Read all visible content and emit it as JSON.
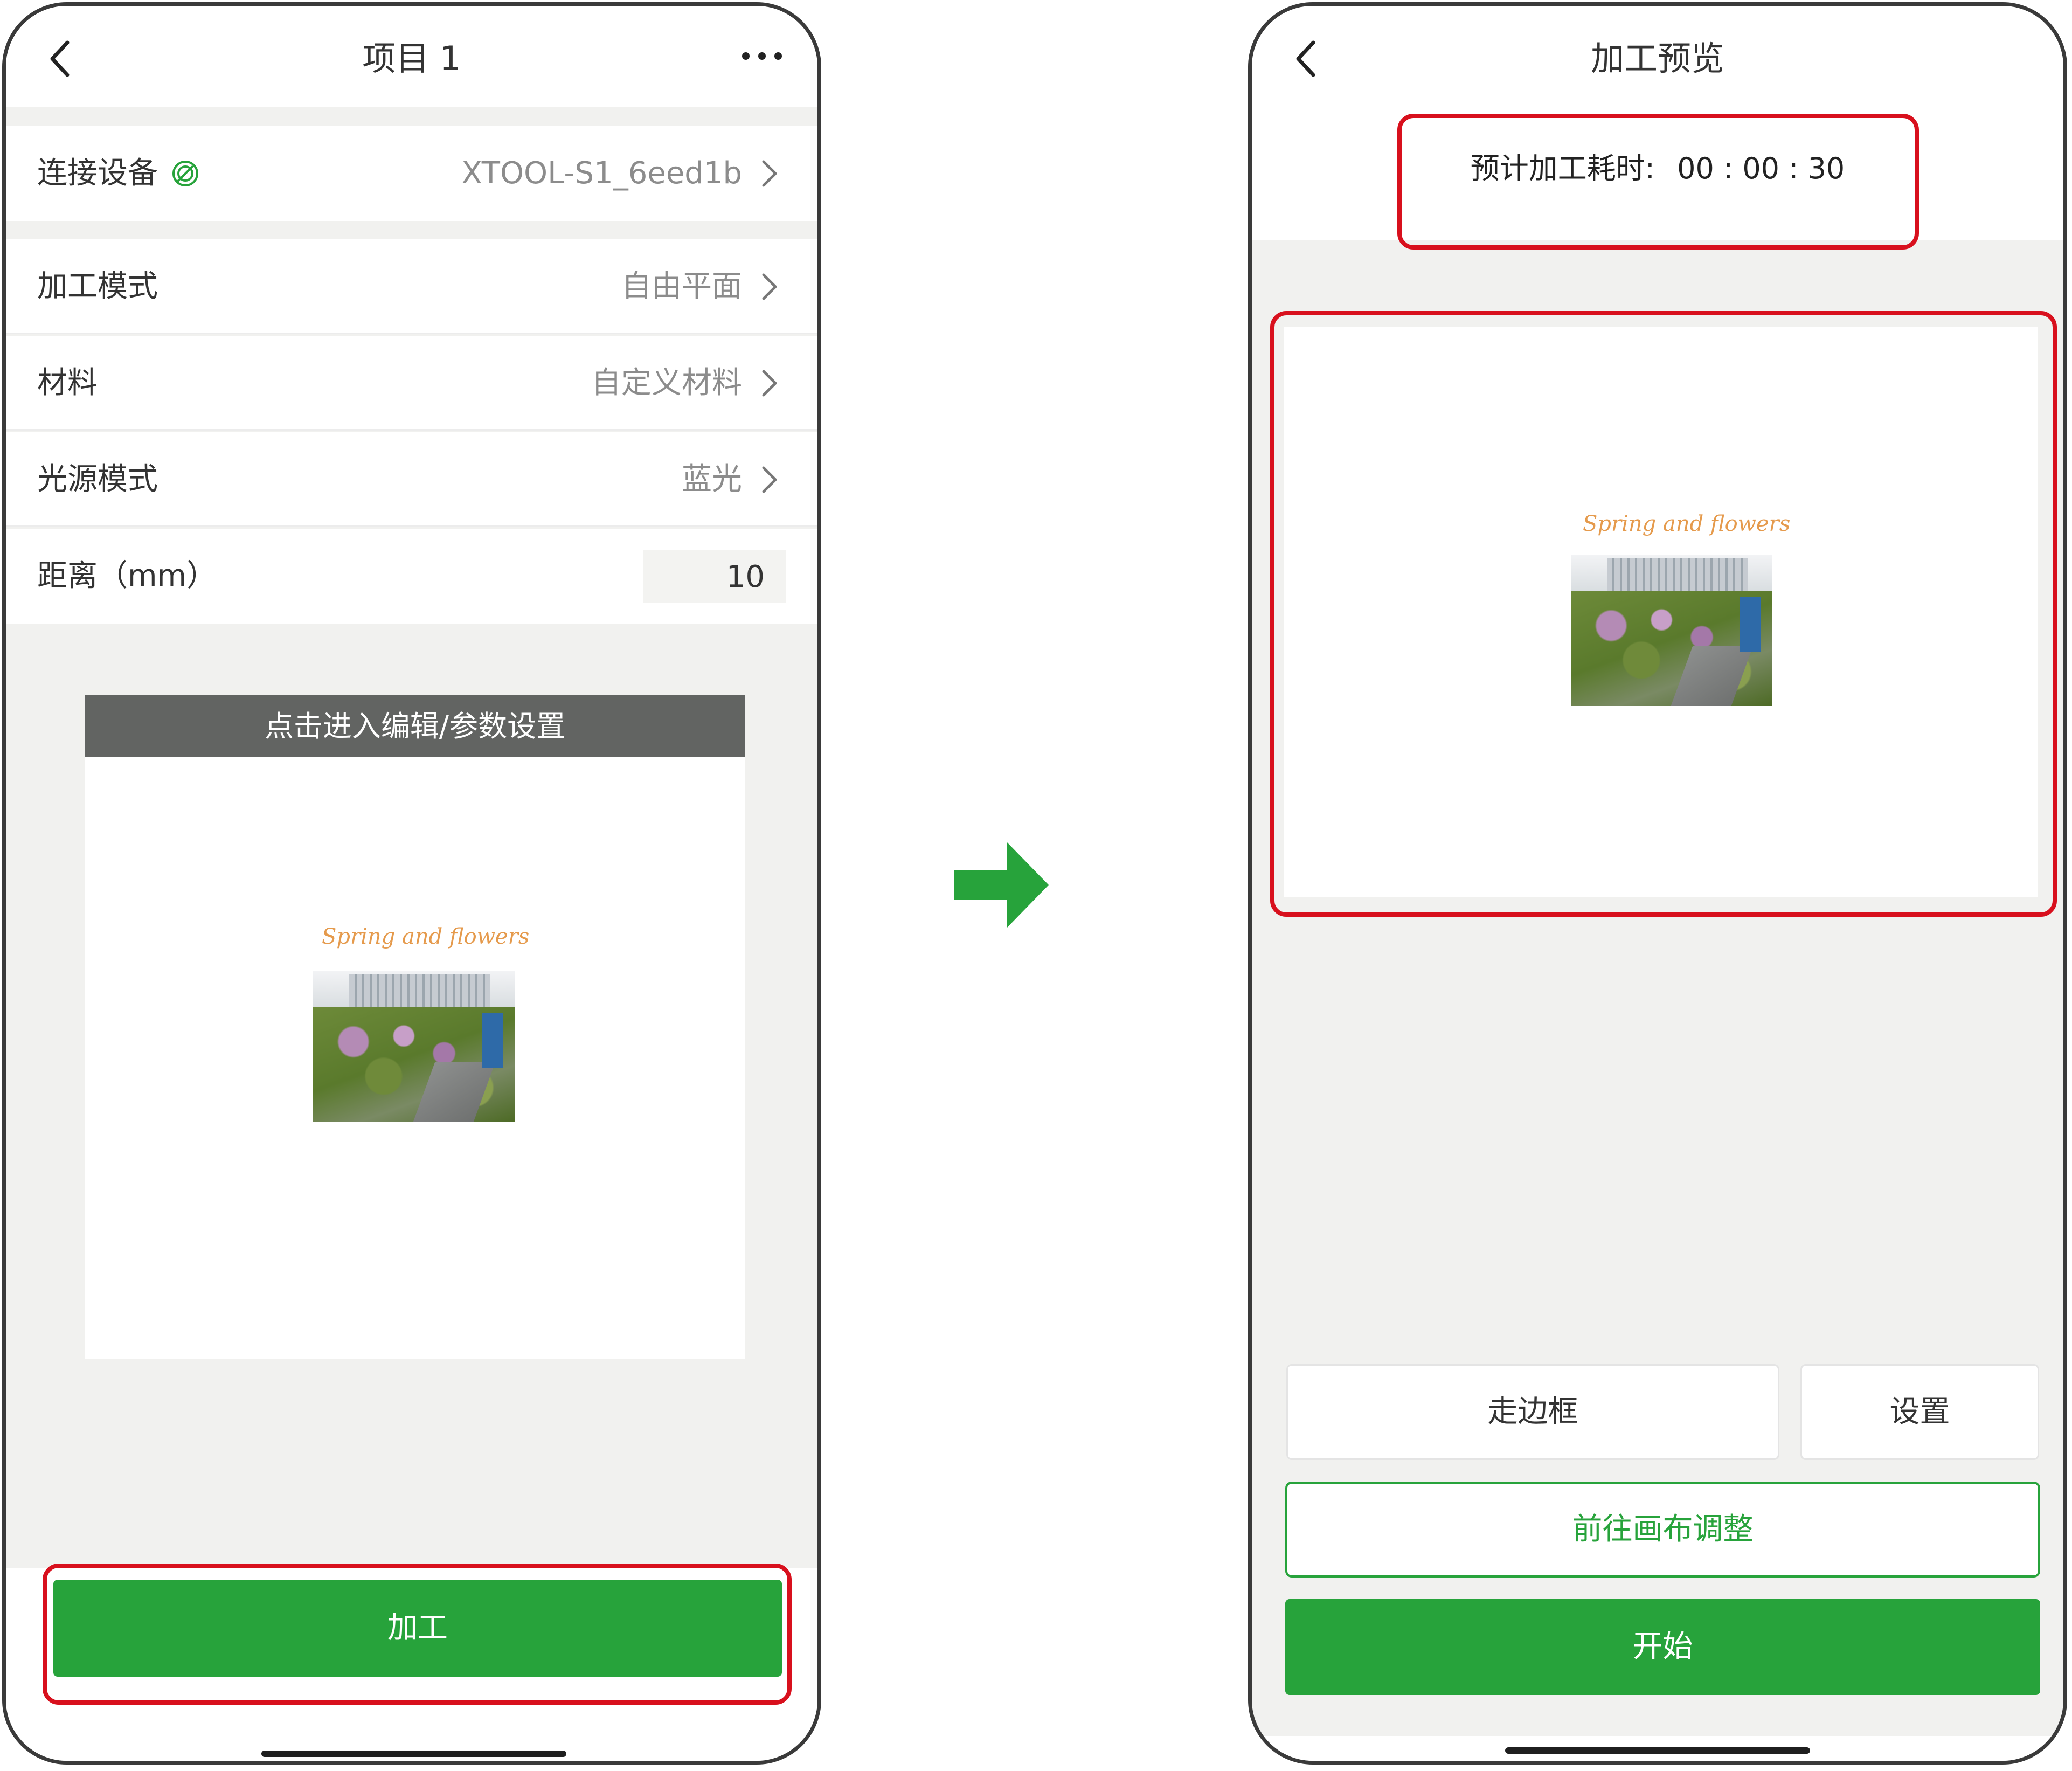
{
  "left_screen": {
    "header": {
      "title": "项目 1",
      "back_icon": "chevron-left-icon",
      "more_icon": "more-horizontal-icon"
    },
    "device_row": {
      "label": "连接设备",
      "status_icon": "connected-icon",
      "value": "XTOOL-S1_6eed1b"
    },
    "settings": [
      {
        "label": "加工模式",
        "value": "自由平面"
      },
      {
        "label": "材料",
        "value": "自定义材料"
      },
      {
        "label": "光源模式",
        "value": "蓝光"
      }
    ],
    "distance": {
      "label": "距离（mm）",
      "value": "10"
    },
    "canvas": {
      "banner": "点击进入编辑/参数设置",
      "image_caption": "Spring and flowers"
    },
    "process_button": "加工"
  },
  "arrow_icon": "right-arrow-icon",
  "right_screen": {
    "header": {
      "title": "加工预览",
      "back_icon": "chevron-left-icon"
    },
    "estimate": {
      "label": "预计加工耗时:",
      "time": "00 : 00 : 30"
    },
    "preview": {
      "image_caption": "Spring and flowers"
    },
    "buttons": {
      "frame": "走边框",
      "settings": "设置",
      "canvas_adjust": "前往画布调整",
      "start": "开始"
    }
  },
  "colors": {
    "accent_green": "#27a33b",
    "highlight_red": "#d8101d",
    "banner_gray": "#626462"
  }
}
